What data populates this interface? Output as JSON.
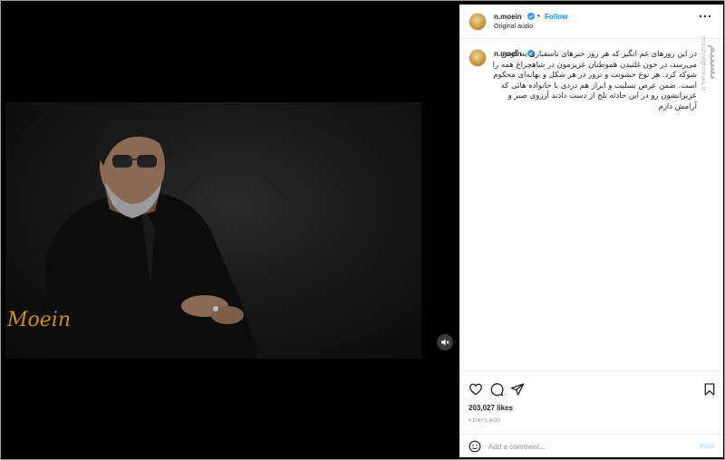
{
  "post": {
    "username": "n.moein",
    "follow_label": "Follow",
    "audio_label": "Original audio",
    "signature_text": "Moein",
    "caption": "در این روزهای غم انگیز که هر روز خبرهای تاسفباری به گوش می‌رسد، در خون غلتیدن هموطنان عزیزمون در شاهچراغ همه را شوکه کرد. هر نوع خشونت و ترور در هر شکل و بهانه‌ای محکوم است. ضمن عرض تسلیت و ابراز هم دردی با خانواده هائی که عزیزانشون رو در این حادثه تلخ از دست دادند آرزوی صبر و آرامش دارم",
    "likes": "203,027 likes",
    "date": "5 DAYS AGO"
  },
  "comment": {
    "placeholder": "Add a comment...",
    "post_label": "Post"
  },
  "watermark": {
    "logo": "تسنیم",
    "site": "mashreghnews.ir"
  },
  "colors": {
    "follow": "#0095f6",
    "signature": "#d58a17",
    "post_disabled": "#b2dffc"
  }
}
